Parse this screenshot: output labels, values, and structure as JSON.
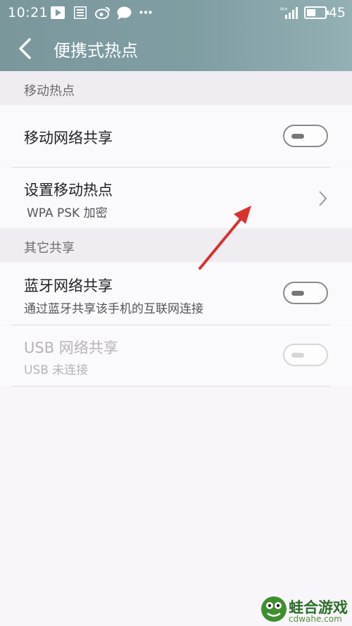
{
  "status_bar": {
    "time": "10:21",
    "battery_pct": "45",
    "notification_icons": [
      "play-icon",
      "news-icon",
      "weibo-icon",
      "message-icon",
      "more-dots-icon"
    ]
  },
  "header": {
    "title": "便携式热点",
    "back_icon": "chevron-left-icon"
  },
  "sections": {
    "mobile_hotspot": {
      "label": "移动热点"
    },
    "other_sharing": {
      "label": "其它共享"
    }
  },
  "rows": {
    "mobile_network_share": {
      "title": "移动网络共享",
      "toggle_on": false
    },
    "setup_hotspot": {
      "title": "设置移动热点",
      "subtitle": "WPA PSK 加密"
    },
    "bluetooth_share": {
      "title": "蓝牙网络共享",
      "subtitle": "通过蓝牙共享该手机的互联网连接",
      "toggle_on": false
    },
    "usb_share": {
      "title": "USB 网络共享",
      "subtitle": "USB 未连接",
      "toggle_on": false,
      "enabled": false
    }
  },
  "watermark": {
    "name": "蛙合游戏",
    "url": "cdwahe.com"
  },
  "colors": {
    "header": "#7f9ea3",
    "annotation_arrow": "#d8322f"
  }
}
